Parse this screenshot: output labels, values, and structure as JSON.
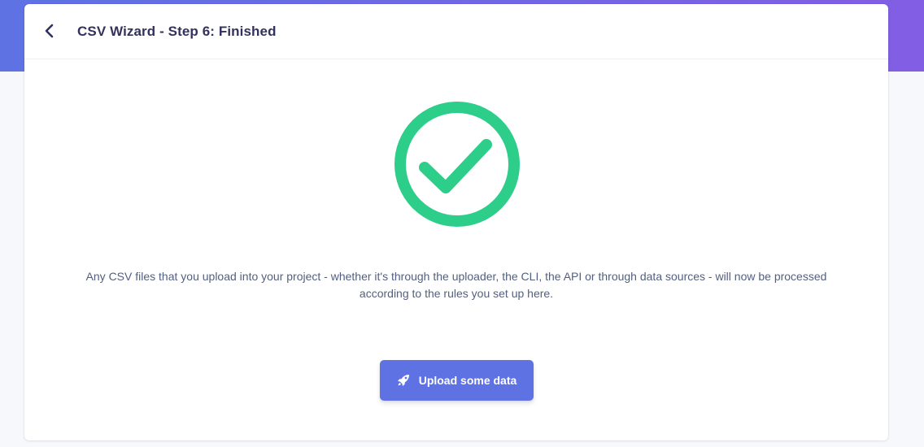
{
  "header": {
    "title": "CSV Wizard - Step 6: Finished",
    "back_icon": "chevron-left-icon"
  },
  "status": {
    "icon": "check-circle-icon",
    "color": "#2dce89"
  },
  "message": {
    "line1": "Any CSV files that you upload into your project - whether it's through the uploader, the CLI, the API or through data sources - will now be processed",
    "line2": "according to the rules you set up here."
  },
  "actions": {
    "upload_label": "Upload some data",
    "upload_icon": "rocket-icon"
  },
  "colors": {
    "accent": "#5e72e4",
    "gradient_end": "#825ee4",
    "success": "#2dce89",
    "title_text": "#32325d",
    "body_text": "#525f7f"
  }
}
